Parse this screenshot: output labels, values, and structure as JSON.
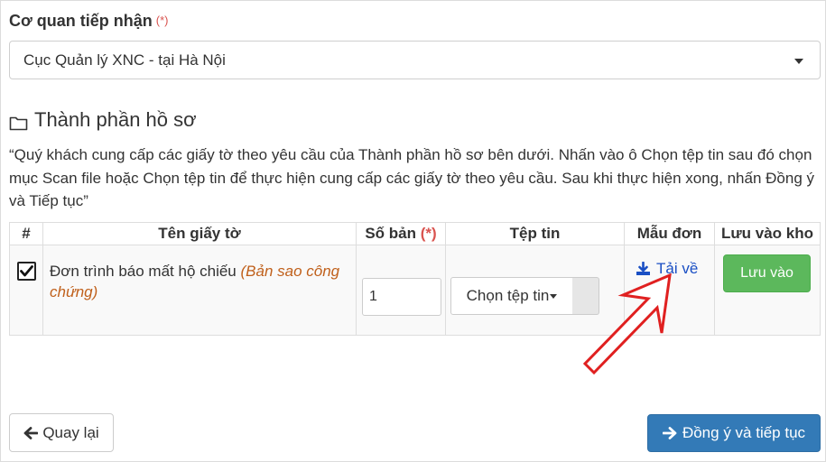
{
  "agency": {
    "label": "Cơ quan tiếp nhận",
    "required_mark": "(*)",
    "selected_value": "Cục Quản lý XNC - tại Hà Nội"
  },
  "section": {
    "title": "Thành phần hồ sơ",
    "icon": "folder-icon",
    "instructions": "“Quý khách cung cấp các giấy tờ theo yêu cầu của Thành phần hồ sơ bên dưới. Nhấn vào ô Chọn tệp tin sau đó chọn mục Scan file hoặc Chọn tệp tin để thực hiện cung cấp các giấy tờ theo yêu cầu. Sau khi thực hiện xong, nhấn Đồng ý và Tiếp tục”"
  },
  "table": {
    "headers": {
      "index": "#",
      "doc_name": "Tên giấy tờ",
      "copies": "Số bản",
      "copies_required": "(*)",
      "file": "Tệp tin",
      "form": "Mẫu đơn",
      "save": "Lưu vào kho"
    },
    "rows": [
      {
        "checked": true,
        "name": "Đơn trình báo mất hộ chiếu",
        "note": "(Bản sao công chứng)",
        "copies": "1",
        "file_button": "Chọn tệp tin",
        "download_label": "Tải về",
        "save_label": "Lưu vào"
      }
    ]
  },
  "footer": {
    "back_label": "Quay lại",
    "next_label": "Đồng ý và tiếp tục"
  },
  "colors": {
    "required": "#d9534f",
    "note": "#c0601b",
    "link": "#1a4fc4",
    "success": "#5cb85c",
    "primary": "#337ab7",
    "annotation_arrow": "#e02020"
  }
}
